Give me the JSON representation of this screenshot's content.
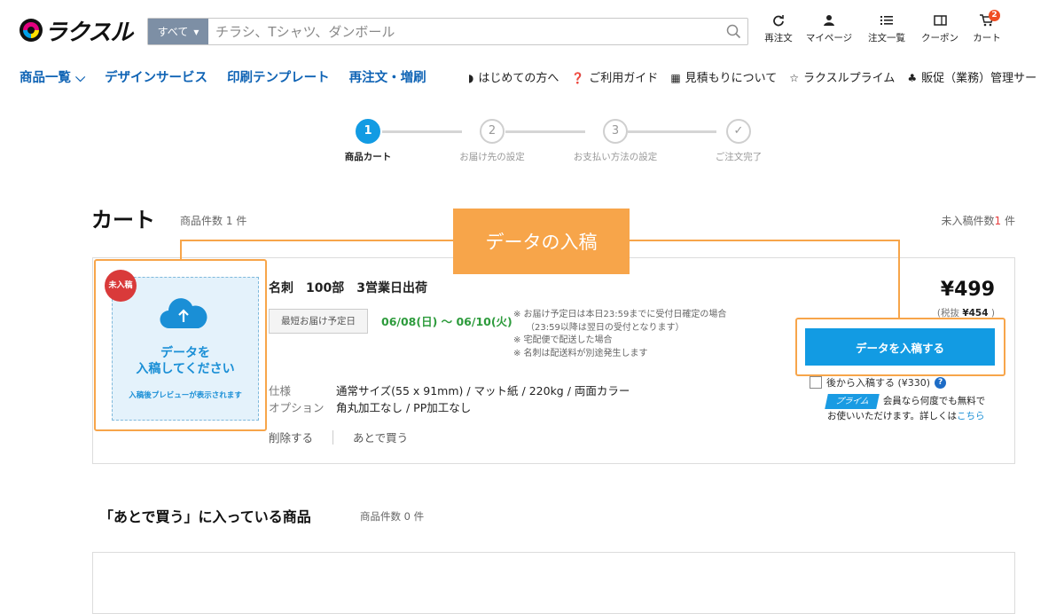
{
  "header": {
    "logo_text": "ラクスル",
    "search": {
      "category": "すべて",
      "placeholder": "チラシ、Tシャツ、ダンボール"
    },
    "nav": [
      {
        "label": "再注文",
        "icon": "reorder-icon"
      },
      {
        "label": "マイページ",
        "icon": "user-icon"
      },
      {
        "label": "注文一覧",
        "icon": "list-icon"
      },
      {
        "label": "クーポン",
        "icon": "coupon-icon"
      },
      {
        "label": "カート",
        "icon": "cart-icon",
        "badge": "2"
      }
    ]
  },
  "category_nav": {
    "main": [
      "商品一覧",
      "デザインサービス",
      "印刷テンプレート",
      "再注文・増刷"
    ],
    "sub": [
      {
        "icon": "shield-icon",
        "label": "はじめての方へ"
      },
      {
        "icon": "question-icon",
        "label": "ご利用ガイド"
      },
      {
        "icon": "calculator-icon",
        "label": "見積もりについて"
      },
      {
        "icon": "star-icon",
        "label": "ラクスルプライム"
      },
      {
        "icon": "sitemap-icon",
        "label": "販促（業務）管理サー"
      }
    ]
  },
  "steps": [
    {
      "num": "1",
      "label": "商品カート"
    },
    {
      "num": "2",
      "label": "お届け先の設定"
    },
    {
      "num": "3",
      "label": "お支払い方法の設定"
    },
    {
      "num": "✓",
      "label": "ご注文完了"
    }
  ],
  "cart": {
    "title": "カート",
    "count_label": "商品件数",
    "count": "1",
    "unit": "件",
    "pending_label": "未入稿件数",
    "pending_count": "1",
    "pending_unit": "件"
  },
  "callout": "データの入稿",
  "item": {
    "unsubmitted_badge": "未入稿",
    "upload_title_1": "データを",
    "upload_title_2": "入稿してください",
    "upload_note": "入稿後プレビューが表示されます",
    "name": "名刺　100部　3営業日出荷",
    "delivery_label": "最短お届け予定日",
    "delivery_date": "06/08(日) ～ 06/10(火)",
    "notes": [
      "※ お届け予定日は本日23:59までに受付日確定の場合",
      "（23:59以降は翌日の受付となります）",
      "※ 宅配便で配送した場合",
      "※ 名刺は配送料が別途発生します"
    ],
    "spec_label": "仕様",
    "spec_value": "通常サイズ(55 x 91mm) / マット紙 / 220kg / 両面カラー",
    "option_label": "オプション",
    "option_value": "角丸加工なし / PP加工なし",
    "delete_label": "削除する",
    "later_label": "あとで買う",
    "price": "¥499",
    "tax_prefix": "(税抜",
    "tax_price": "¥454",
    "tax_suffix": ")",
    "upload_button": "データを入稿する",
    "later_upload": "後から入稿する (¥330)",
    "prime_tag": "プライム",
    "prime_text_1": "会員なら何度でも無料で",
    "prime_text_2": "お使いいただけます。詳しくは",
    "prime_link": "こちら"
  },
  "saved": {
    "title": "「あとで買う」に入っている商品",
    "count_label": "商品件数",
    "count": "0",
    "unit": "件"
  }
}
